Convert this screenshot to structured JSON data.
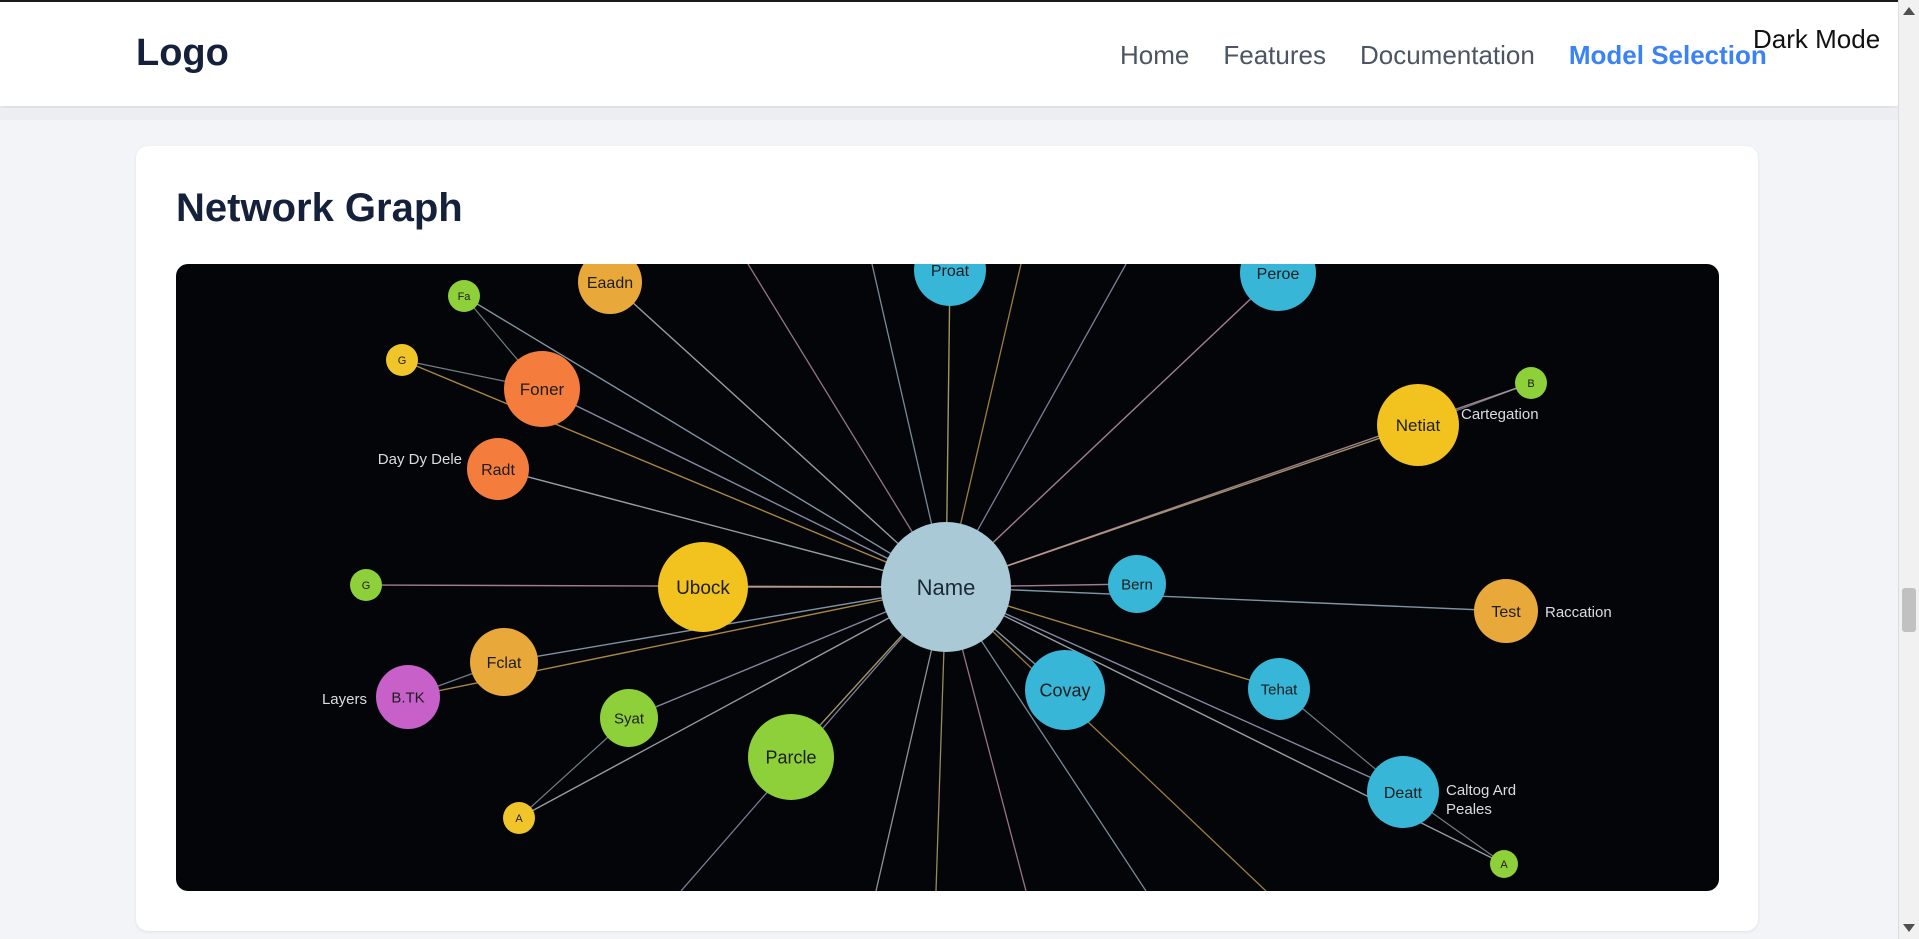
{
  "header": {
    "logo": "Logo",
    "nav": [
      {
        "label": "Home",
        "active": false
      },
      {
        "label": "Features",
        "active": false
      },
      {
        "label": "Documentation",
        "active": false
      },
      {
        "label": "Model Selection",
        "active": true
      }
    ],
    "dark_mode_label": "Dark Mode"
  },
  "card": {
    "title": "Network Graph"
  },
  "graph": {
    "center": {
      "label": "Name",
      "color": "#a9c9d6"
    },
    "nodes": [
      {
        "label": "Eaadn",
        "color": "#e8a93a"
      },
      {
        "label": "Proat",
        "color": "#38b6d8"
      },
      {
        "label": "Peroe",
        "color": "#38b6d8"
      },
      {
        "label": "Fa",
        "color": "#8ed03a"
      },
      {
        "label": "G",
        "color": "#f0c52a"
      },
      {
        "label": "Foner",
        "color": "#f47c3c"
      },
      {
        "label": "Radt",
        "color": "#f47c3c"
      },
      {
        "label": "Ubock",
        "color": "#f2c31e"
      },
      {
        "label": "G",
        "color": "#8ed03a"
      },
      {
        "label": "Fclat",
        "color": "#e8a93a"
      },
      {
        "label": "B.TK",
        "color": "#c760c8"
      },
      {
        "label": "Syat",
        "color": "#8ed03a"
      },
      {
        "label": "A",
        "color": "#f0c52a"
      },
      {
        "label": "Parcle",
        "color": "#8ed03a"
      },
      {
        "label": "Bern",
        "color": "#38b6d8"
      },
      {
        "label": "Covay",
        "color": "#38b6d8"
      },
      {
        "label": "Tehat",
        "color": "#38b6d8"
      },
      {
        "label": "Deatt",
        "color": "#38b6d8"
      },
      {
        "label": "A",
        "color": "#8ed03a"
      },
      {
        "label": "Netiat",
        "color": "#f2c31e"
      },
      {
        "label": "B",
        "color": "#8ed03a"
      },
      {
        "label": "Test",
        "color": "#e8a93a"
      }
    ],
    "annotations": [
      {
        "text": "Day Dy Dele",
        "anchor": "end"
      },
      {
        "text": "Layers",
        "anchor": "end"
      },
      {
        "text": "Cartegation",
        "anchor": "start"
      },
      {
        "text": "Raccation",
        "anchor": "start"
      },
      {
        "text": "Caltog Ard",
        "anchor": "start"
      },
      {
        "text": "Peales",
        "anchor": "start"
      }
    ]
  }
}
